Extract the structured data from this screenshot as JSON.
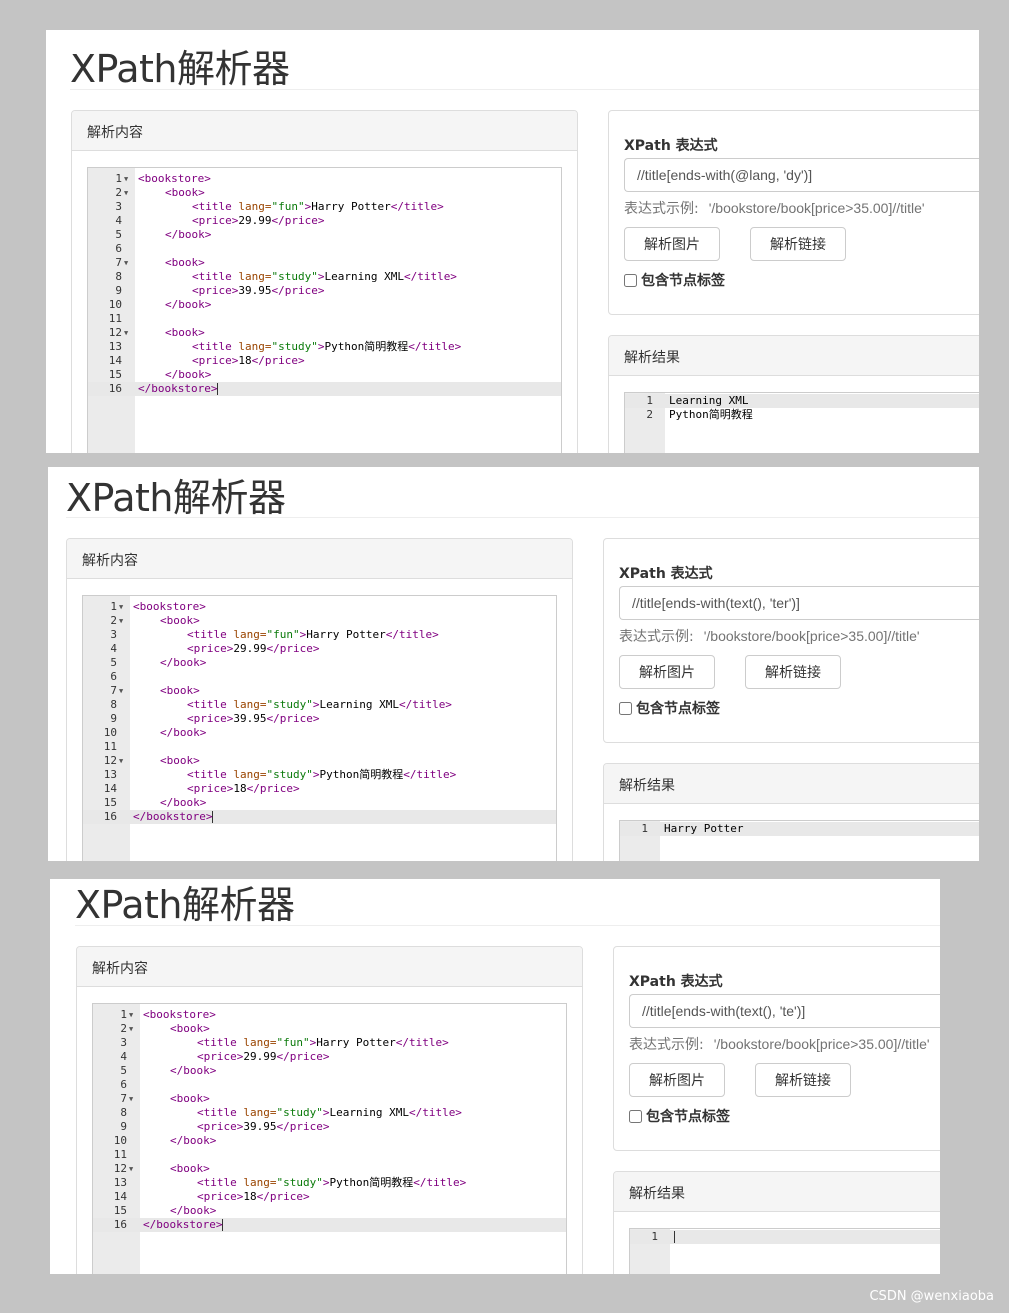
{
  "app_title": "XPath解析器",
  "content_panel_title": "解析内容",
  "result_panel_title": "解析结果",
  "xpath_label": "XPath 表达式",
  "example_label": "表达式示例:",
  "example_value": "'/bookstore/book[price>35.00]//title'",
  "btn_parse_image": "解析图片",
  "btn_parse_link": "解析链接",
  "include_tags_label": "包含节点标签",
  "source_code": [
    {
      "n": "1",
      "fold": true,
      "indent": 0,
      "parts": [
        [
          "t",
          "<bookstore>"
        ]
      ]
    },
    {
      "n": "2",
      "fold": true,
      "indent": 1,
      "parts": [
        [
          "t",
          "<book>"
        ]
      ]
    },
    {
      "n": "3",
      "fold": false,
      "indent": 2,
      "parts": [
        [
          "t",
          "<title "
        ],
        [
          "a",
          "lang="
        ],
        [
          "s",
          "\"fun\""
        ],
        [
          "t",
          ">"
        ],
        [
          "x",
          "Harry Potter"
        ],
        [
          "t",
          "</title>"
        ]
      ]
    },
    {
      "n": "4",
      "fold": false,
      "indent": 2,
      "parts": [
        [
          "t",
          "<price>"
        ],
        [
          "x",
          "29.99"
        ],
        [
          "t",
          "</price>"
        ]
      ]
    },
    {
      "n": "5",
      "fold": false,
      "indent": 1,
      "parts": [
        [
          "t",
          "</book>"
        ]
      ]
    },
    {
      "n": "6",
      "fold": false,
      "indent": 0,
      "parts": []
    },
    {
      "n": "7",
      "fold": true,
      "indent": 1,
      "parts": [
        [
          "t",
          "<book>"
        ]
      ]
    },
    {
      "n": "8",
      "fold": false,
      "indent": 2,
      "parts": [
        [
          "t",
          "<title "
        ],
        [
          "a",
          "lang="
        ],
        [
          "s",
          "\"study\""
        ],
        [
          "t",
          ">"
        ],
        [
          "x",
          "Learning XML"
        ],
        [
          "t",
          "</title>"
        ]
      ]
    },
    {
      "n": "9",
      "fold": false,
      "indent": 2,
      "parts": [
        [
          "t",
          "<price>"
        ],
        [
          "x",
          "39.95"
        ],
        [
          "t",
          "</price>"
        ]
      ]
    },
    {
      "n": "10",
      "fold": false,
      "indent": 1,
      "parts": [
        [
          "t",
          "</book>"
        ]
      ]
    },
    {
      "n": "11",
      "fold": false,
      "indent": 0,
      "parts": []
    },
    {
      "n": "12",
      "fold": true,
      "indent": 1,
      "parts": [
        [
          "t",
          "<book>"
        ]
      ]
    },
    {
      "n": "13",
      "fold": false,
      "indent": 2,
      "parts": [
        [
          "t",
          "<title "
        ],
        [
          "a",
          "lang="
        ],
        [
          "s",
          "\"study\""
        ],
        [
          "t",
          ">"
        ],
        [
          "x",
          "Python简明教程"
        ],
        [
          "t",
          "</title>"
        ]
      ]
    },
    {
      "n": "14",
      "fold": false,
      "indent": 2,
      "parts": [
        [
          "t",
          "<price>"
        ],
        [
          "x",
          "18"
        ],
        [
          "t",
          "</price>"
        ]
      ]
    },
    {
      "n": "15",
      "fold": false,
      "indent": 1,
      "parts": [
        [
          "t",
          "</book>"
        ]
      ]
    },
    {
      "n": "16",
      "fold": false,
      "indent": 0,
      "parts": [
        [
          "t",
          "</bookstore>"
        ]
      ],
      "active": true
    }
  ],
  "screens": [
    {
      "xpath": "//title[ends-with(@lang, 'dy')]",
      "results": [
        "Learning XML",
        "Python简明教程"
      ]
    },
    {
      "xpath": "//title[ends-with(text(), 'ter')]",
      "results": [
        "Harry Potter"
      ]
    },
    {
      "xpath": "//title[ends-with(text(), 'te')]",
      "results": [
        ""
      ]
    }
  ],
  "watermark": "CSDN @wenxiaoba",
  "colors": {
    "tag": "#800080",
    "attr": "#994400",
    "string": "#0a7a0a",
    "panel_heading_bg": "#f5f5f5",
    "gutter_bg": "#ebebeb",
    "page_bg": "#c4c4c4"
  }
}
